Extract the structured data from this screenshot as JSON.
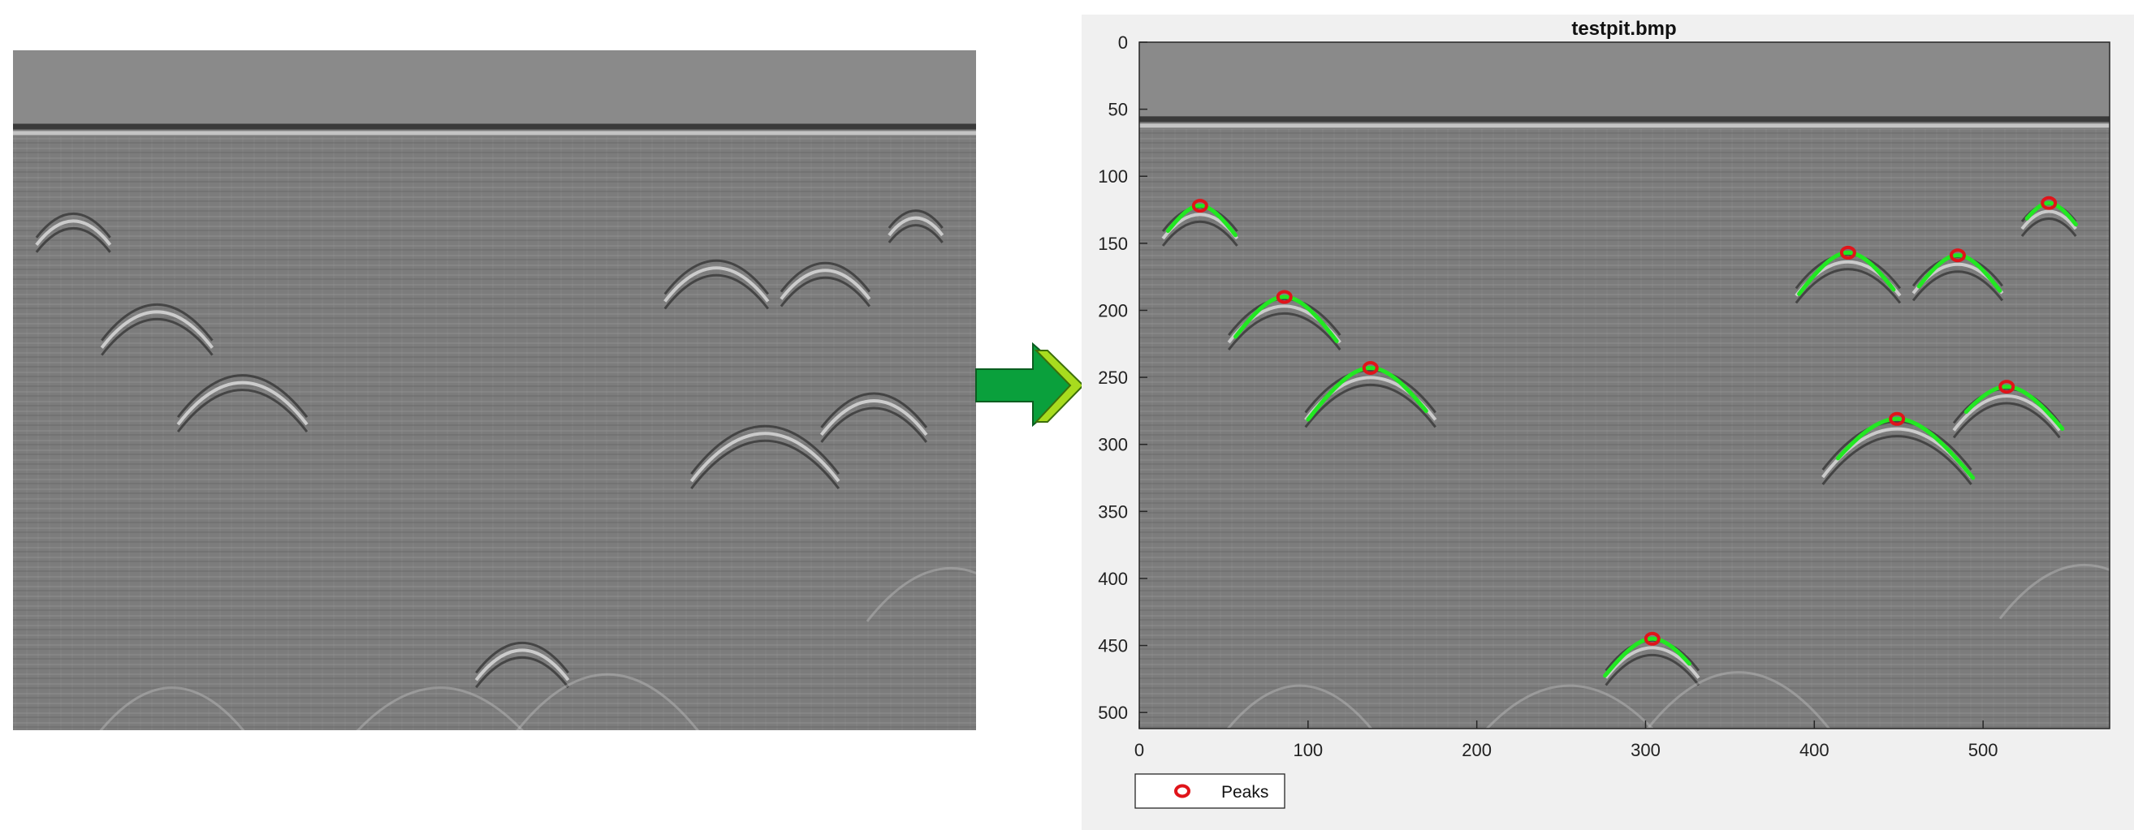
{
  "colors": {
    "figure_bg": "#f0f0f0",
    "radar_base": "#7c7c7c",
    "air_layer": "#8a8a8a",
    "hyperbola_fit": "#22e822",
    "peak_marker": "#e0141a",
    "arrow_dark": "#0aa03c",
    "arrow_light": "#a8dc1e"
  },
  "chart_data": {
    "type": "scatter",
    "title": "testpit.bmp",
    "xlabel": "",
    "ylabel": "",
    "xlim": [
      0,
      575
    ],
    "ylim": [
      512,
      0
    ],
    "y_reversed": true,
    "xticks": [
      0,
      100,
      200,
      300,
      400,
      500
    ],
    "yticks": [
      0,
      50,
      100,
      150,
      200,
      250,
      300,
      350,
      400,
      450,
      500
    ],
    "grid": false,
    "legend_position": "bottom-left",
    "series": [
      {
        "name": "Peaks",
        "marker": "circle",
        "x": [
          36,
          86,
          137,
          304,
          420,
          485,
          539,
          449,
          514
        ],
        "y": [
          122,
          190,
          243,
          445,
          157,
          159,
          120,
          281,
          257
        ]
      }
    ],
    "fitted_hyperbolas": [
      {
        "x0": 36,
        "y0": 122,
        "x_from": 17,
        "x_to": 57
      },
      {
        "x0": 86,
        "y0": 190,
        "x_from": 57,
        "x_to": 117
      },
      {
        "x0": 137,
        "y0": 243,
        "x_from": 100,
        "x_to": 170
      },
      {
        "x0": 304,
        "y0": 445,
        "x_from": 276,
        "x_to": 326
      },
      {
        "x0": 420,
        "y0": 157,
        "x_from": 391,
        "x_to": 447
      },
      {
        "x0": 485,
        "y0": 159,
        "x_from": 462,
        "x_to": 510
      },
      {
        "x0": 539,
        "y0": 120,
        "x_from": 526,
        "x_to": 555
      },
      {
        "x0": 449,
        "y0": 281,
        "x_from": 414,
        "x_to": 494
      },
      {
        "x0": 514,
        "y0": 257,
        "x_from": 490,
        "x_to": 547
      }
    ]
  }
}
